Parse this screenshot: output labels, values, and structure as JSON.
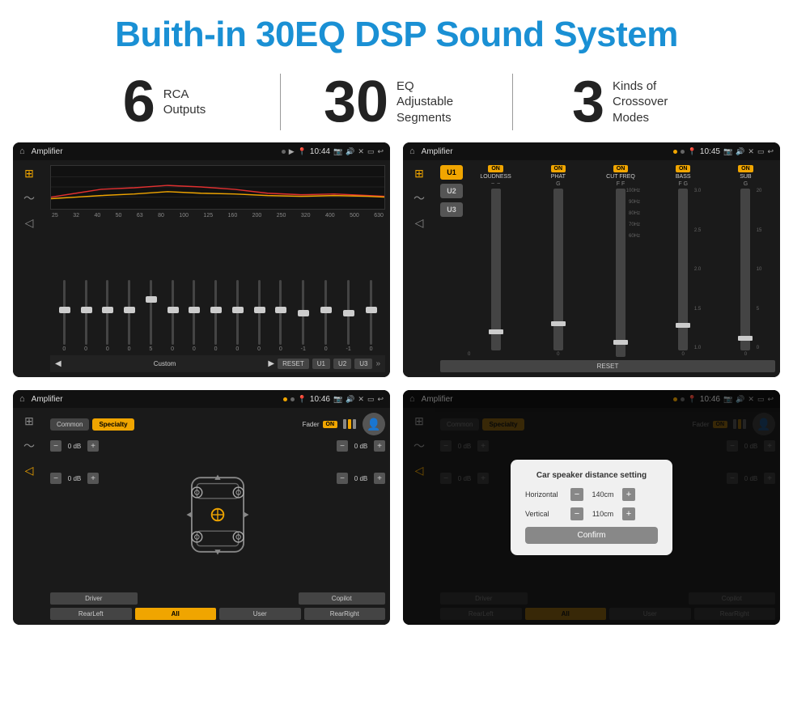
{
  "header": {
    "title": "Buith-in 30EQ DSP Sound System"
  },
  "stats": [
    {
      "number": "6",
      "text": "RCA\nOutputs"
    },
    {
      "number": "30",
      "text": "EQ Adjustable\nSegments"
    },
    {
      "number": "3",
      "text": "Kinds of\nCrossover Modes"
    }
  ],
  "screens": [
    {
      "id": "screen1",
      "title": "Amplifier",
      "time": "10:44",
      "type": "eq"
    },
    {
      "id": "screen2",
      "title": "Amplifier",
      "time": "10:45",
      "type": "amp"
    },
    {
      "id": "screen3",
      "title": "Amplifier",
      "time": "10:46",
      "type": "fader"
    },
    {
      "id": "screen4",
      "title": "Amplifier",
      "time": "10:46",
      "type": "fader-modal"
    }
  ],
  "eq": {
    "frequencies": [
      "25",
      "32",
      "40",
      "50",
      "63",
      "80",
      "100",
      "125",
      "160",
      "200",
      "250",
      "320",
      "400",
      "500",
      "630"
    ],
    "values": [
      "0",
      "0",
      "0",
      "0",
      "5",
      "0",
      "0",
      "0",
      "0",
      "0",
      "0",
      "-1",
      "0",
      "-1"
    ],
    "preset": "Custom",
    "buttons": [
      "RESET",
      "U1",
      "U2",
      "U3"
    ]
  },
  "amp": {
    "u_buttons": [
      "U1",
      "U2",
      "U3"
    ],
    "channels": [
      {
        "name": "LOUDNESS",
        "on": true
      },
      {
        "name": "PHAT",
        "on": true
      },
      {
        "name": "CUT FREQ",
        "on": true
      },
      {
        "name": "BASS",
        "on": true
      },
      {
        "name": "SUB",
        "on": true
      }
    ],
    "reset_label": "RESET"
  },
  "fader": {
    "common_label": "Common",
    "specialty_label": "Specialty",
    "fader_label": "Fader",
    "on_label": "ON",
    "db_values": [
      "0 dB",
      "0 dB",
      "0 dB",
      "0 dB"
    ],
    "buttons": {
      "driver": "Driver",
      "copilot": "Copilot",
      "rear_left": "RearLeft",
      "all": "All",
      "user": "User",
      "rear_right": "RearRight"
    }
  },
  "modal": {
    "title": "Car speaker distance setting",
    "horizontal_label": "Horizontal",
    "horizontal_value": "140cm",
    "vertical_label": "Vertical",
    "vertical_value": "110cm",
    "confirm_label": "Confirm"
  },
  "colors": {
    "accent": "#1a90d4",
    "orange": "#f0a500",
    "dark_bg": "#1a1a1a",
    "text_light": "#dddddd"
  }
}
